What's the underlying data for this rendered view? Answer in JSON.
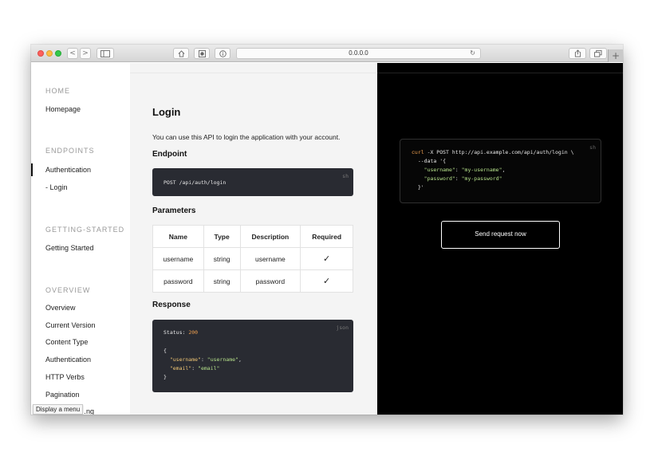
{
  "browser": {
    "url": "0.0.0.0",
    "back_glyph": "<",
    "forward_glyph": ">",
    "reload_glyph": "↻",
    "plus_glyph": "+"
  },
  "sidebar": {
    "sections": [
      {
        "title": "HOME",
        "items": [
          "Homepage"
        ]
      },
      {
        "title": "ENDPOINTS",
        "items": [
          "Authentication",
          "- Login"
        ]
      },
      {
        "title": "GETTING-STARTED",
        "items": [
          "Getting Started"
        ]
      },
      {
        "title": "OVERVIEW",
        "items": [
          "Overview",
          "Current Version",
          "Content Type",
          "Authentication",
          "HTTP Verbs",
          "Pagination",
          "…ng"
        ]
      }
    ],
    "tooltip": "Display a menu"
  },
  "content": {
    "title": "Login",
    "intro": "You can use this API to login the application with your account.",
    "endpoint_heading": "Endpoint",
    "endpoint_lang": "sh",
    "endpoint_code": "POST /api/auth/login",
    "parameters_heading": "Parameters",
    "parameters_table": {
      "headers": [
        "Name",
        "Type",
        "Description",
        "Required"
      ],
      "rows": [
        [
          "username",
          "string",
          "username",
          "✓"
        ],
        [
          "password",
          "string",
          "password",
          "✓"
        ]
      ]
    },
    "response_heading": "Response",
    "response_lang": "json",
    "response_status_label": "Status:",
    "response_status_code": "200",
    "response_lines": {
      "open": "{",
      "username_key": "\"username\"",
      "username_val": "\"username\"",
      "email_key": "\"email\"",
      "email_val": "\"email\"",
      "close": "}"
    }
  },
  "example": {
    "lang": "sh",
    "curl_cmd": "curl",
    "curl_rest": " -X POST http://api.example.com/api/auth/login \\",
    "data_line": "  --data '{",
    "username_key": "\"username\"",
    "username_val": "\"my-username\"",
    "password_key": "\"password\"",
    "password_val": "\"my-password\"",
    "close_line": "  }'",
    "send_button": "Send request now"
  },
  "colors": {
    "dark_panel": "#000000",
    "code_bg": "#292b32",
    "key_color": "#f0c674",
    "string_color": "#b5e08a",
    "status_color": "#f0a050"
  }
}
